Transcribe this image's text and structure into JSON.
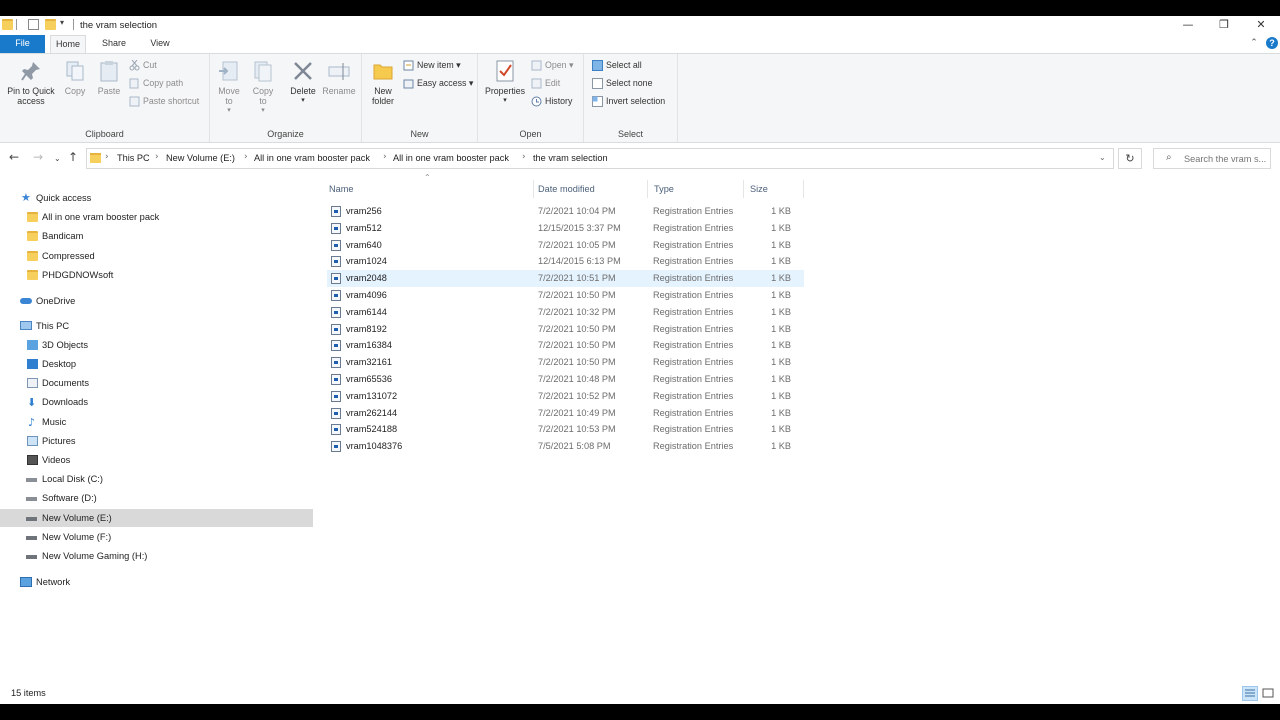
{
  "window": {
    "title": "the vram selection",
    "minimize": "—",
    "maximize": "❐",
    "close": "✕"
  },
  "ribbon_tabs": [
    "File",
    "Home",
    "Share",
    "View"
  ],
  "ribbon": {
    "clipboard": {
      "label": "Clipboard",
      "pin": "Pin to Quick access",
      "copy": "Copy",
      "paste": "Paste",
      "cut": "Cut",
      "copy_path": "Copy path",
      "paste_shortcut": "Paste shortcut"
    },
    "organize": {
      "label": "Organize",
      "move_to": "Move to",
      "copy_to": "Copy to",
      "delete": "Delete",
      "rename": "Rename"
    },
    "new": {
      "label": "New",
      "new_folder": "New folder",
      "new_item": "New item ▾",
      "easy_access": "Easy access ▾"
    },
    "open": {
      "label": "Open",
      "properties": "Properties",
      "open": "Open ▾",
      "edit": "Edit",
      "history": "History"
    },
    "select": {
      "label": "Select",
      "select_all": "Select all",
      "select_none": "Select none",
      "invert_selection": "Invert selection"
    }
  },
  "address": {
    "breadcrumbs": [
      "This PC",
      "New Volume (E:)",
      "All in one vram booster pack",
      "All in one vram booster pack",
      "the vram selection"
    ],
    "search_placeholder": "Search the vram s..."
  },
  "nav_pane": {
    "quick_access": "Quick access",
    "quick_items": [
      "All in one vram booster pack",
      "Bandicam",
      "Compressed",
      "PHDGDNOWsoft"
    ],
    "onedrive": "OneDrive",
    "this_pc": "This PC",
    "pc_items": [
      "3D Objects",
      "Desktop",
      "Documents",
      "Downloads",
      "Music",
      "Pictures",
      "Videos",
      "Local Disk (C:)",
      "Software (D:)",
      "New Volume (E:)",
      "New Volume (F:)",
      "New Volume Gaming (H:)"
    ],
    "network": "Network"
  },
  "columns": [
    "Name",
    "Date modified",
    "Type",
    "Size"
  ],
  "files": [
    {
      "name": "vram256",
      "date": "7/2/2021 10:04 PM",
      "type": "Registration Entries",
      "size": "1 KB"
    },
    {
      "name": "vram512",
      "date": "12/15/2015 3:37 PM",
      "type": "Registration Entries",
      "size": "1 KB"
    },
    {
      "name": "vram640",
      "date": "7/2/2021 10:05 PM",
      "type": "Registration Entries",
      "size": "1 KB"
    },
    {
      "name": "vram1024",
      "date": "12/14/2015 6:13 PM",
      "type": "Registration Entries",
      "size": "1 KB"
    },
    {
      "name": "vram2048",
      "date": "7/2/2021 10:51 PM",
      "type": "Registration Entries",
      "size": "1 KB"
    },
    {
      "name": "vram4096",
      "date": "7/2/2021 10:50 PM",
      "type": "Registration Entries",
      "size": "1 KB"
    },
    {
      "name": "vram6144",
      "date": "7/2/2021 10:32 PM",
      "type": "Registration Entries",
      "size": "1 KB"
    },
    {
      "name": "vram8192",
      "date": "7/2/2021 10:50 PM",
      "type": "Registration Entries",
      "size": "1 KB"
    },
    {
      "name": "vram16384",
      "date": "7/2/2021 10:50 PM",
      "type": "Registration Entries",
      "size": "1 KB"
    },
    {
      "name": "vram32161",
      "date": "7/2/2021 10:50 PM",
      "type": "Registration Entries",
      "size": "1 KB"
    },
    {
      "name": "vram65536",
      "date": "7/2/2021 10:48 PM",
      "type": "Registration Entries",
      "size": "1 KB"
    },
    {
      "name": "vram131072",
      "date": "7/2/2021 10:52 PM",
      "type": "Registration Entries",
      "size": "1 KB"
    },
    {
      "name": "vram262144",
      "date": "7/2/2021 10:49 PM",
      "type": "Registration Entries",
      "size": "1 KB"
    },
    {
      "name": "vram524188",
      "date": "7/2/2021 10:53 PM",
      "type": "Registration Entries",
      "size": "1 KB"
    },
    {
      "name": "vram1048376",
      "date": "7/5/2021 5:08 PM",
      "type": "Registration Entries",
      "size": "1 KB"
    }
  ],
  "status": {
    "item_count": "15 items"
  },
  "colors": {
    "accent": "#1979ca",
    "selection_row": "#e5f3ff",
    "nav_selected": "#d9d9d9"
  }
}
